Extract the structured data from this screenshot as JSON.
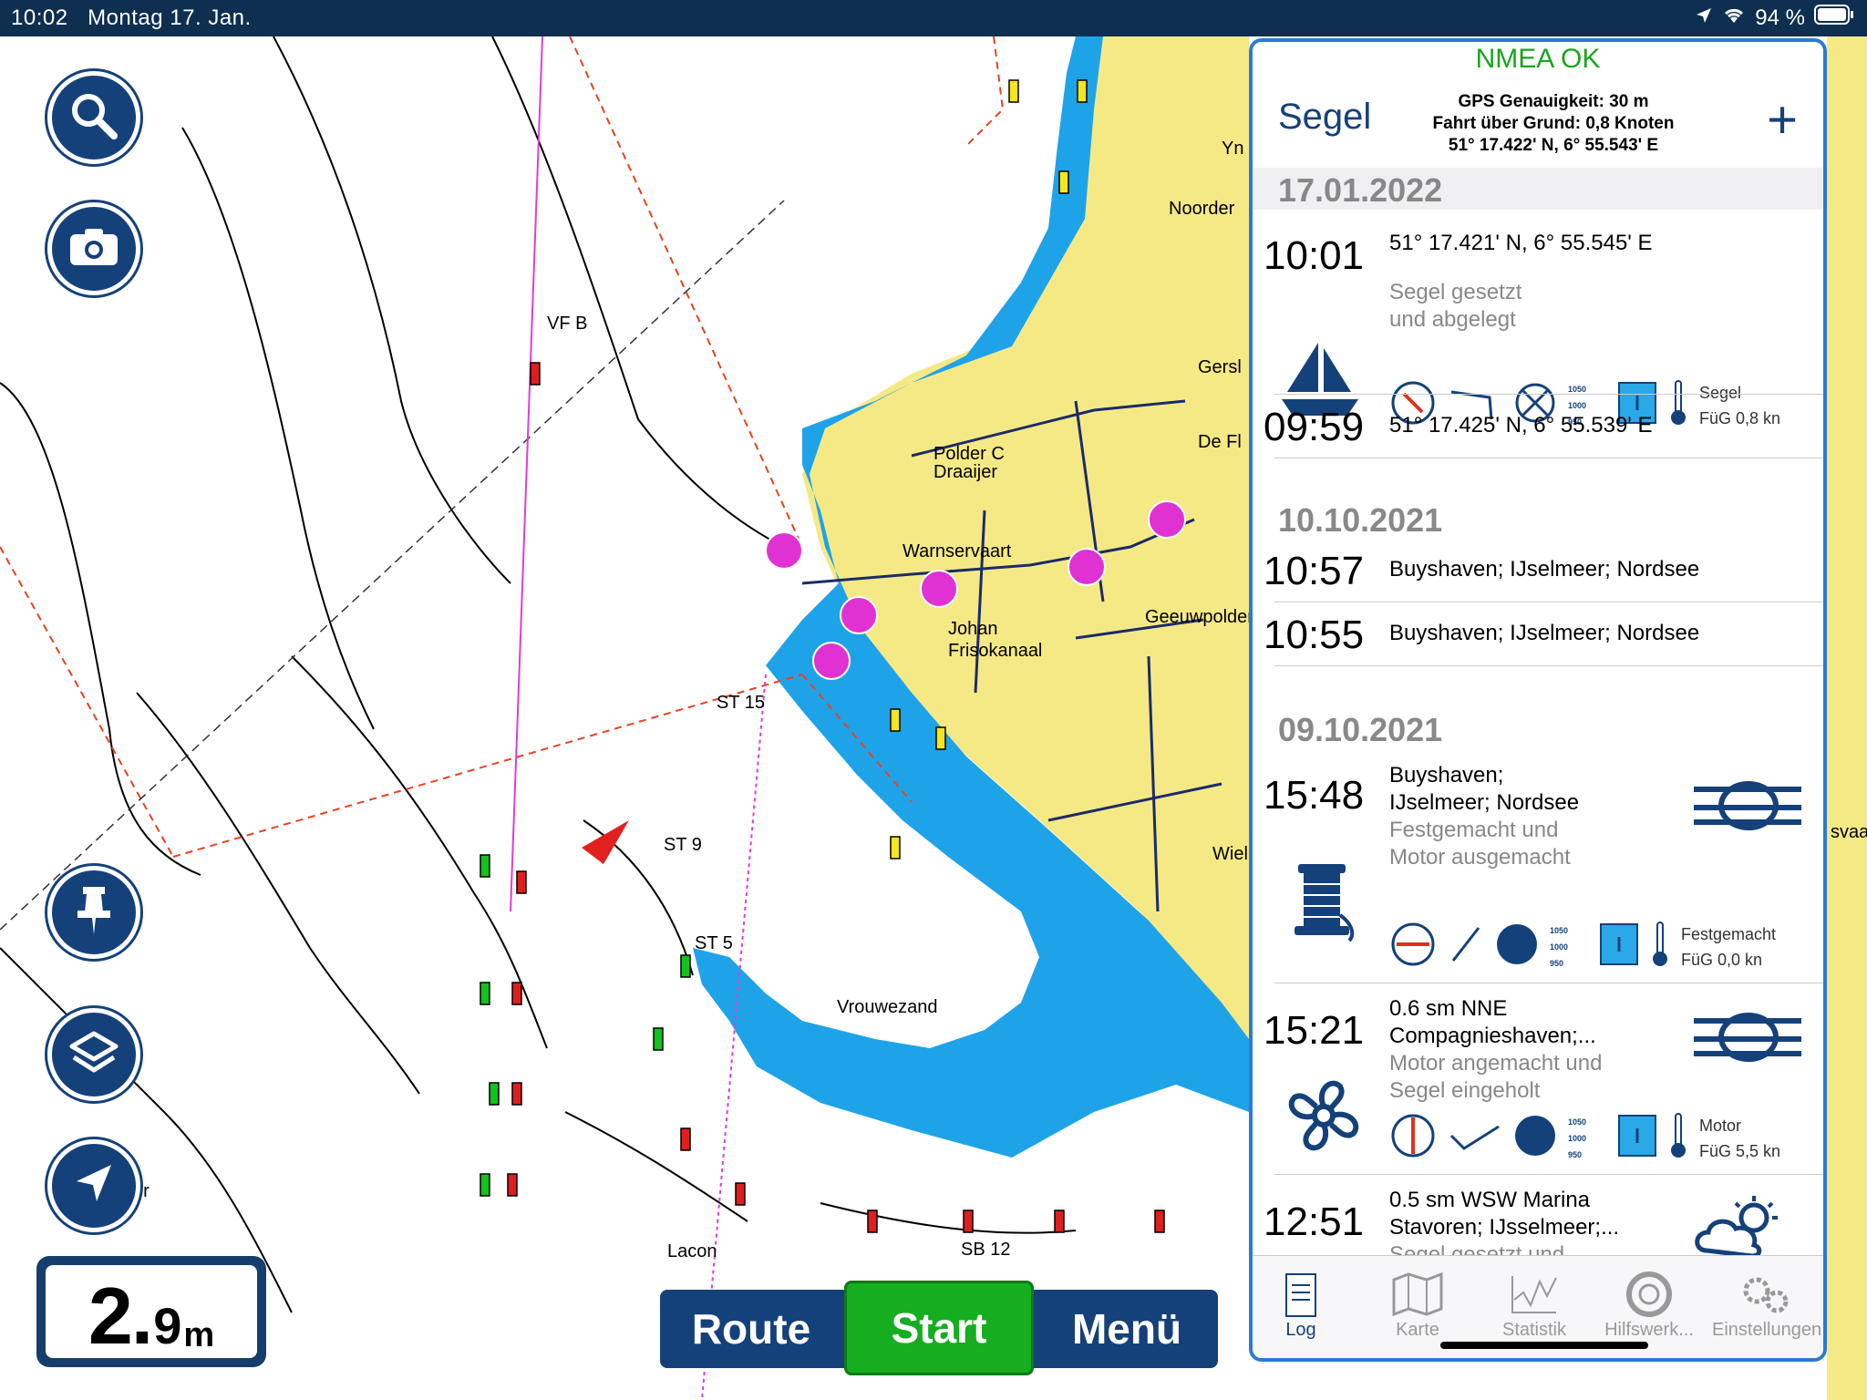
{
  "status": {
    "time": "10:02",
    "date": "Montag 17. Jan.",
    "battery": "94 %"
  },
  "map": {
    "labels": [
      "VF B",
      "Polder C\nDraaijer",
      "Warnservaart",
      "Johan\nFrisokanaal",
      "Geeuwpolder",
      "ST 15",
      "ST 9",
      "ST 5",
      "Vrouwezand",
      "Lacon",
      "SB 12",
      "Noorder",
      "Gersl",
      "De Fl",
      "Wiel",
      "Yn",
      "svaa",
      "er"
    ]
  },
  "depth": {
    "value_big": "2.",
    "value_small": "9",
    "unit": "m"
  },
  "bottom": {
    "route": "Route",
    "start": "Start",
    "menu": "Menü"
  },
  "panel": {
    "nmea": "NMEA OK",
    "title": "Segel",
    "gps_accuracy": "GPS Genauigkeit: 30 m",
    "sog": "Fahrt über Grund: 0,8 Knoten",
    "position": "51° 17.422' N, 6° 55.543' E",
    "plus": "+",
    "sections": [
      {
        "date": "17.01.2022",
        "entries": [
          {
            "time": "10:01",
            "line1": "51° 17.421' N, 6° 55.545' E",
            "gray1": "Segel gesetzt",
            "gray2": "und abgelegt",
            "mode": "Segel",
            "fug": "FüG 0,8 kn"
          },
          {
            "time": "09:59",
            "line1": "51° 17.425' N, 6° 55.539' E"
          }
        ]
      },
      {
        "date": "10.10.2021",
        "entries": [
          {
            "time": "10:57",
            "line1": "Buyshaven; IJselmeer; Nordsee"
          },
          {
            "time": "10:55",
            "line1": "Buyshaven; IJselmeer; Nordsee"
          }
        ]
      },
      {
        "date": "09.10.2021",
        "entries": [
          {
            "time": "15:48",
            "line1": "Buyshaven;",
            "line2": "IJselmeer; Nordsee",
            "gray1": "Festgemacht und",
            "gray2": "Motor ausgemacht",
            "mode": "Festgemacht",
            "fug": "FüG 0,0 kn"
          },
          {
            "time": "15:21",
            "line1": "0.6 sm NNE",
            "line2": "Compagnieshaven;...",
            "gray1": "Motor angemacht und",
            "gray2": "Segel eingeholt",
            "mode": "Motor",
            "fug": "FüG 5,5 kn"
          },
          {
            "time": "12:51",
            "line1": "0.5 sm WSW Marina",
            "line2": "Stavoren; IJsselmeer;...",
            "gray1": "Segel gesetzt und"
          }
        ]
      }
    ],
    "baro": [
      "1050",
      "1000",
      "950"
    ],
    "tabs": [
      "Log",
      "Karte",
      "Statistik",
      "Hilfswerk...",
      "Einstellungen"
    ]
  }
}
